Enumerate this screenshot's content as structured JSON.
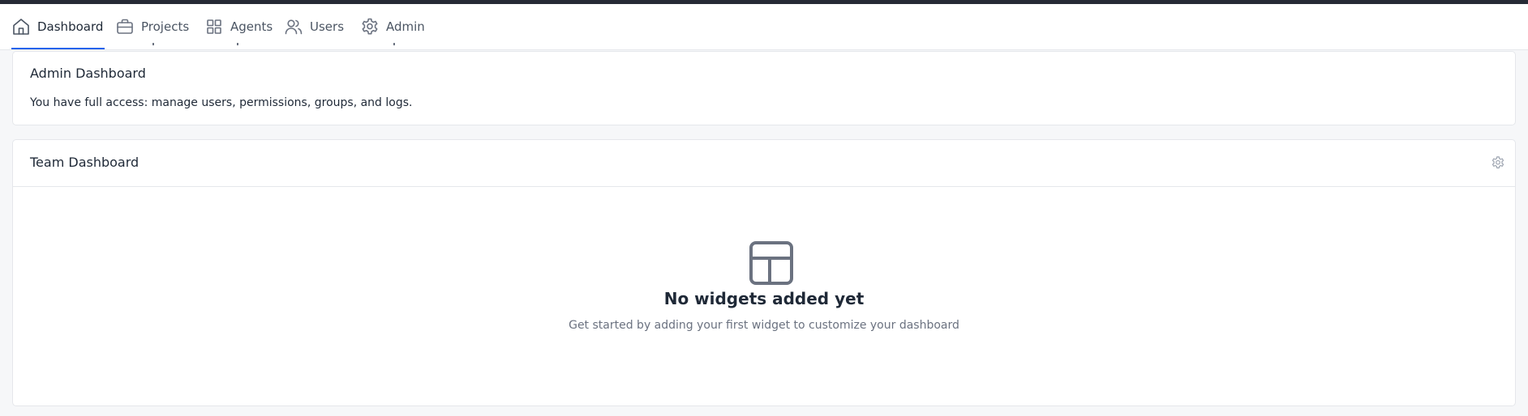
{
  "nav": {
    "items": [
      {
        "label": "Dashboard",
        "icon": "home-icon",
        "active": true
      },
      {
        "label": "Projects",
        "icon": "briefcase-icon",
        "active": false
      },
      {
        "label": "Agents",
        "icon": "grid-icon",
        "active": false
      },
      {
        "label": "Users",
        "icon": "users-icon",
        "active": false
      },
      {
        "label": "Admin",
        "icon": "gear-icon",
        "active": false
      }
    ],
    "active_color": "#2563eb"
  },
  "admin_card": {
    "title": "Admin Dashboard",
    "description": "You have full access: manage users, permissions, groups, and logs."
  },
  "team_card": {
    "title": "Team Dashboard",
    "settings_icon": "gear-icon",
    "empty_state": {
      "icon": "layout-grid-icon",
      "title": "No widgets added yet",
      "subtitle": "Get started by adding your first widget to customize your dashboard"
    }
  }
}
